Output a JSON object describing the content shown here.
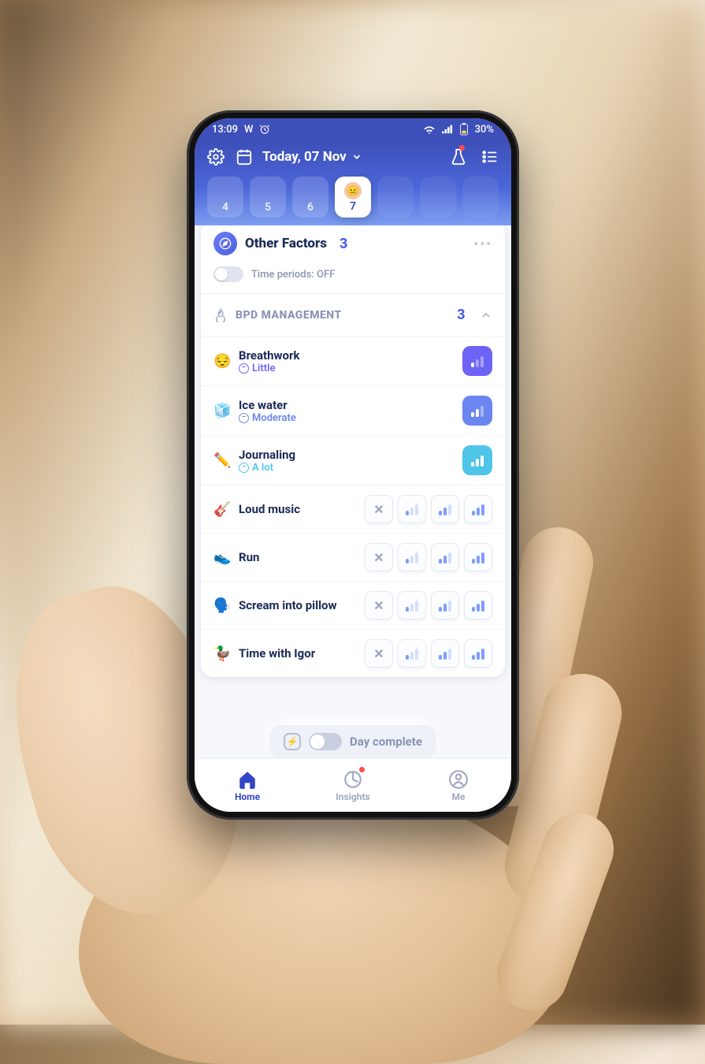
{
  "status": {
    "time": "13:09",
    "battery": "30%"
  },
  "header": {
    "date": "Today, 07 Nov",
    "days": [
      {
        "n": "4",
        "active": false,
        "dim": false
      },
      {
        "n": "5",
        "active": false,
        "dim": false
      },
      {
        "n": "6",
        "active": false,
        "dim": false
      },
      {
        "n": "7",
        "active": true,
        "dim": false
      },
      {
        "n": "",
        "active": false,
        "dim": true
      },
      {
        "n": "",
        "active": false,
        "dim": true
      },
      {
        "n": "",
        "active": false,
        "dim": true
      }
    ]
  },
  "card": {
    "title": "Other Factors",
    "count": "3",
    "toggle_label": "Time periods: OFF"
  },
  "section": {
    "title": "BPD MANAGEMENT",
    "count": "3"
  },
  "rated": [
    {
      "emoji": "😔",
      "name": "Breathwork",
      "level": "Little",
      "color": "#6d63f5",
      "lvlColor": "#6d63f5",
      "bars": 1
    },
    {
      "emoji": "🧊",
      "name": "Ice water",
      "level": "Moderate",
      "color": "#6b86f0",
      "lvlColor": "#6b86f0",
      "bars": 2
    },
    {
      "emoji": "✏️",
      "name": "Journaling",
      "level": "A lot",
      "color": "#4fc5e8",
      "lvlColor": "#4fc5e8",
      "bars": 3
    }
  ],
  "unrated": [
    {
      "emoji": "🎸",
      "name": "Loud music"
    },
    {
      "emoji": "👟",
      "name": "Run"
    },
    {
      "emoji": "🗣️",
      "name": "Scream into pillow"
    },
    {
      "emoji": "🦆",
      "name": "Time with Igor"
    }
  ],
  "complete": {
    "label": "Day complete"
  },
  "nav": {
    "home": "Home",
    "insights": "Insights",
    "me": "Me"
  }
}
